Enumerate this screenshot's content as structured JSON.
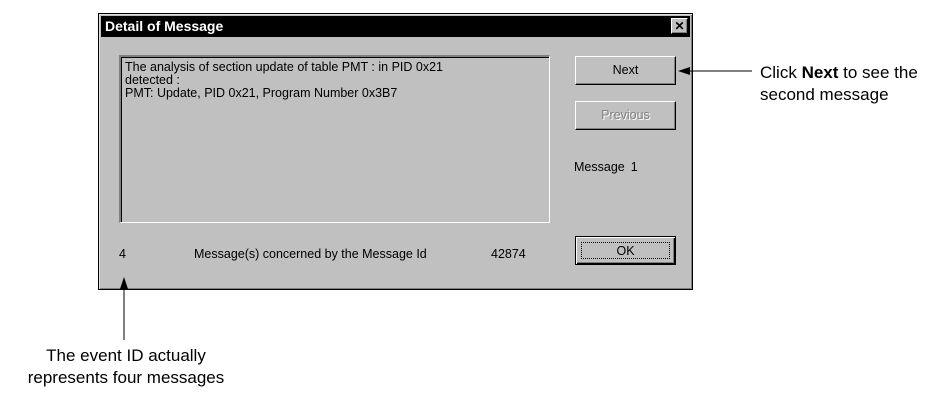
{
  "dialog": {
    "title": "Detail of Message",
    "close_glyph": "✕",
    "message_lines": [
      "The analysis of section update of table PMT :  in PID 0x21",
      "detected :",
      "PMT: Update, PID 0x21, Program Number 0x3B7"
    ],
    "buttons": {
      "next": "Next",
      "previous": "Previous",
      "ok": "OK"
    },
    "counter_label": "Message",
    "counter_value": "1",
    "status": {
      "count": "4",
      "text": "Message(s) concerned by the Message Id",
      "message_id": "42874"
    }
  },
  "callouts": {
    "next_prefix": "Click ",
    "next_bold": "Next",
    "next_suffix": " to see the",
    "next_line2": "second message",
    "event_line1": "The event ID actually",
    "event_line2": "represents four messages"
  }
}
